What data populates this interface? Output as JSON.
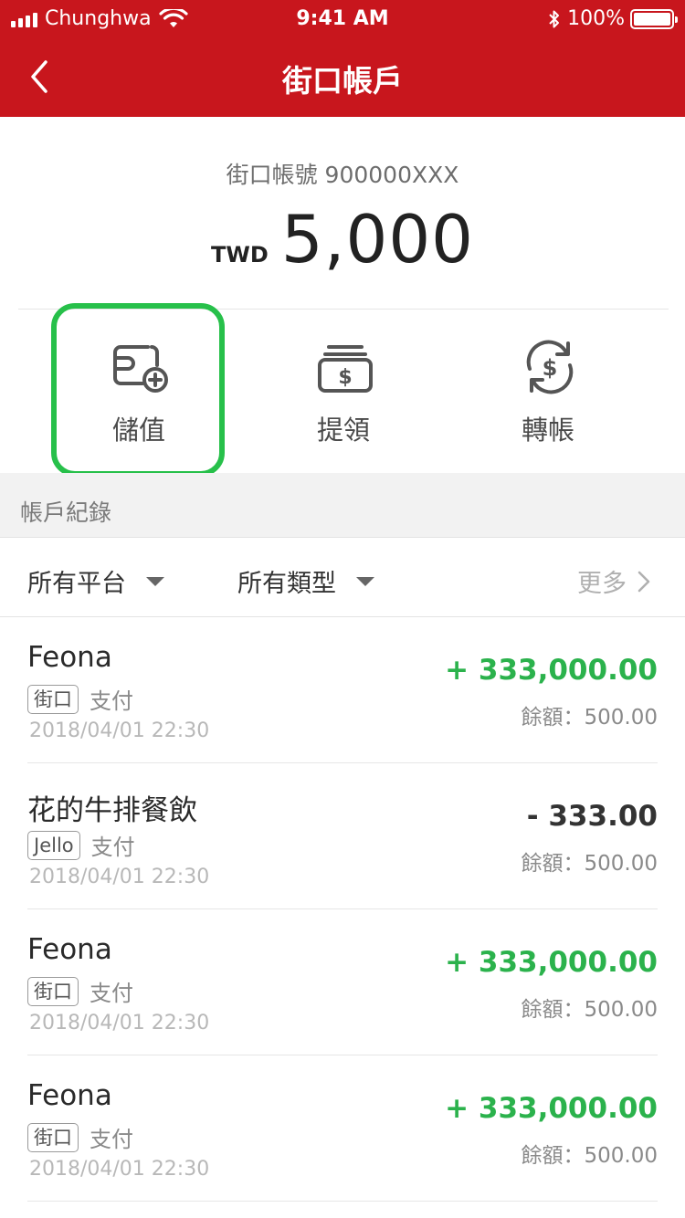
{
  "status_bar": {
    "carrier": "Chunghwa",
    "time": "9:41 AM",
    "battery": "100%"
  },
  "nav": {
    "title": "街口帳戶"
  },
  "account": {
    "number_text": "街口帳號 900000XXX",
    "currency": "TWD",
    "balance": "5,000"
  },
  "actions": [
    {
      "label": "儲值",
      "icon": "wallet-plus-icon"
    },
    {
      "label": "提領",
      "icon": "cash-withdraw-icon"
    },
    {
      "label": "轉帳",
      "icon": "dollar-transfer-icon"
    }
  ],
  "section": {
    "title": "帳戶紀錄"
  },
  "filters": {
    "platform": "所有平台",
    "type": "所有類型",
    "more": "更多"
  },
  "transactions": [
    {
      "name": "Feona",
      "tag": "街口",
      "type": "支付",
      "date": "2018/04/01 22:30",
      "amount": "+ 333,000.00",
      "direction": "positive",
      "balance": "餘額：500.00"
    },
    {
      "name": "花的牛排餐飲",
      "tag": "Jello",
      "type": "支付",
      "date": "2018/04/01 22:30",
      "amount": "- 333.00",
      "direction": "negative",
      "balance": "餘額：500.00"
    },
    {
      "name": "Feona",
      "tag": "街口",
      "type": "支付",
      "date": "2018/04/01 22:30",
      "amount": "+ 333,000.00",
      "direction": "positive",
      "balance": "餘額：500.00"
    },
    {
      "name": "Feona",
      "tag": "街口",
      "type": "支付",
      "date": "2018/04/01 22:30",
      "amount": "+ 333,000.00",
      "direction": "positive",
      "balance": "餘額：500.00"
    }
  ],
  "colors": {
    "brand_red": "#c8161d",
    "positive_green": "#2bb24c",
    "highlight_green": "#27c04a"
  }
}
